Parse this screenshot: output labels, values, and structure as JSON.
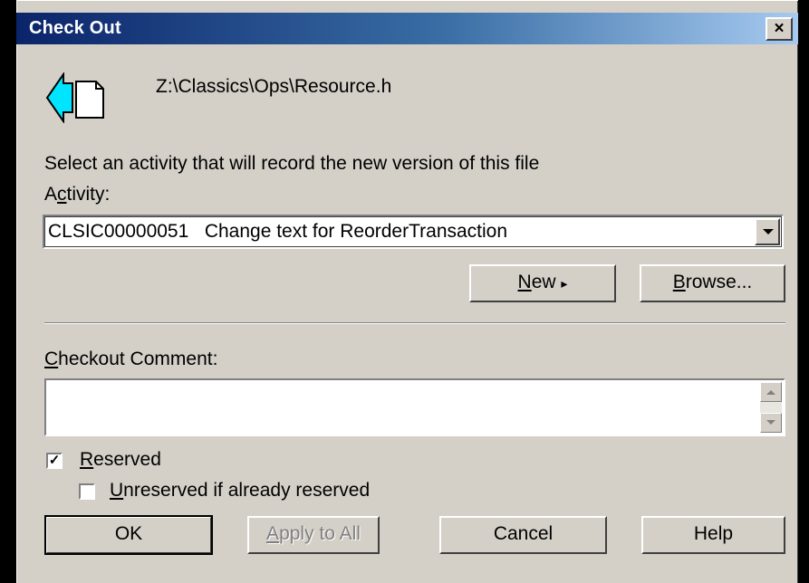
{
  "window": {
    "title": "Check Out",
    "close_label": "×"
  },
  "file": {
    "icon": "checkout-file-icon",
    "path": "Z:\\Classics\\Ops\\Resource.h"
  },
  "activity": {
    "prompt": "Select an activity that will record the new version of this file",
    "label_pre": "A",
    "label_accel": "c",
    "label_post": "tivity:",
    "selected_id": "CLSIC00000051",
    "selected_text": "Change text for ReorderTransaction"
  },
  "buttons": {
    "new_accel": "N",
    "new_rest": "ew",
    "new_arrow": "▸",
    "browse_accel": "B",
    "browse_rest": "rowse...",
    "ok": "OK",
    "apply_accel": "A",
    "apply_rest": "pply to All",
    "cancel": "Cancel",
    "help": "Help"
  },
  "comment": {
    "label_accel": "C",
    "label_rest": "heckout Comment:",
    "value": ""
  },
  "options": {
    "reserved": {
      "checked": true,
      "check_mark": "✓",
      "label_accel": "R",
      "label_rest": "eserved"
    },
    "unreserved": {
      "checked": false,
      "check_mark": "",
      "label_accel": "U",
      "label_rest": "nreserved if already reserved"
    }
  },
  "colors": {
    "title_gradient_start": "#0a246a",
    "title_gradient_end": "#a6caf0",
    "face": "#d4d0c8",
    "icon_cyan": "#00e5ff"
  }
}
